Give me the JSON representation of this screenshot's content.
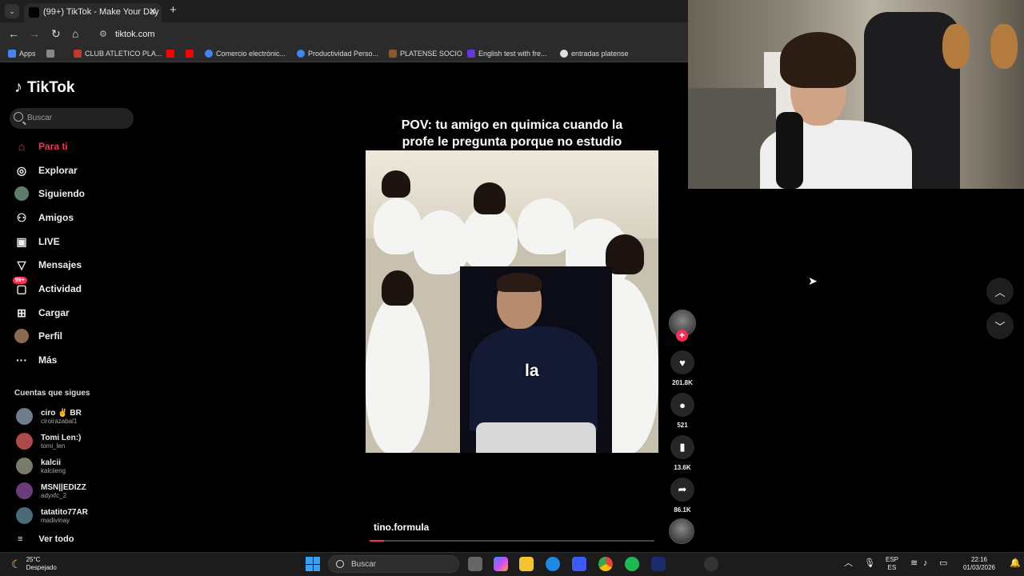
{
  "browser": {
    "tab_title": "(99+) TikTok - Make Your Day",
    "url": "tiktok.com",
    "bookmarks": [
      {
        "label": "Apps",
        "icon": "apps-icon",
        "color": "#4285f4"
      },
      {
        "label": "",
        "icon": "grid-icon",
        "color": "#888888"
      },
      {
        "label": "CLUB ATLETICO PLA...",
        "icon": "club-icon",
        "color": "#c0392b"
      },
      {
        "label": "",
        "icon": "youtube-icon",
        "color": "#ff0000"
      },
      {
        "label": "",
        "icon": "youtube-icon",
        "color": "#ff0000"
      },
      {
        "label": "Comercio electrónic...",
        "icon": "google-icon",
        "color": "#4285f4"
      },
      {
        "label": "Productividad Perso...",
        "icon": "google-icon",
        "color": "#4285f4"
      },
      {
        "label": "PLATENSE SOCIO",
        "icon": "platense-icon",
        "color": "#8b5a2b"
      },
      {
        "label": "English test with fre...",
        "icon": "ef-icon",
        "color": "#6a35d9"
      },
      {
        "label": "entradas platense",
        "icon": "globe-icon",
        "color": "#dddddd"
      }
    ]
  },
  "tiktok": {
    "logo": "TikTok",
    "search_placeholder": "Buscar",
    "nav": [
      {
        "label": "Para ti",
        "icon": "home-icon",
        "active": true
      },
      {
        "label": "Explorar",
        "icon": "compass-icon"
      },
      {
        "label": "Siguiendo",
        "icon": "following-avatar-icon"
      },
      {
        "label": "Amigos",
        "icon": "friends-icon"
      },
      {
        "label": "LIVE",
        "icon": "live-icon"
      },
      {
        "label": "Mensajes",
        "icon": "messages-icon"
      },
      {
        "label": "Actividad",
        "icon": "activity-icon",
        "badge": "99+"
      },
      {
        "label": "Cargar",
        "icon": "upload-icon"
      },
      {
        "label": "Perfil",
        "icon": "profile-avatar-icon"
      },
      {
        "label": "Más",
        "icon": "more-icon"
      }
    ],
    "following_title": "Cuentas que sigues",
    "following": [
      {
        "name": "ciro ✌ BR",
        "handle": "ciroirazabal1"
      },
      {
        "name": "Tomi Len:)",
        "handle": "tomi_len"
      },
      {
        "name": "kalcii",
        "handle": "kalciieng"
      },
      {
        "name": "MSN||EDIZZ",
        "handle": "adyxfc_2"
      },
      {
        "name": "tatatito77AR",
        "handle": "madivinay"
      }
    ],
    "see_all": "Ver todo",
    "video": {
      "caption_line1": "POV: tu amigo en quimica  cuando la",
      "caption_line2": "profe le pregunta porque no estudio",
      "subtitle": "la",
      "author": "tino.formula",
      "progress_fraction": 0.05
    },
    "actions": {
      "likes": "201.8K",
      "comments": "521",
      "saves": "13.6K",
      "shares": "86.1K"
    }
  },
  "taskbar": {
    "weather_temp": "25°C",
    "weather_desc": "Despejado",
    "search_placeholder": "Buscar",
    "lang_line1": "ESP",
    "lang_line2": "ES",
    "time": "22:16",
    "date": "01/03/2026"
  }
}
